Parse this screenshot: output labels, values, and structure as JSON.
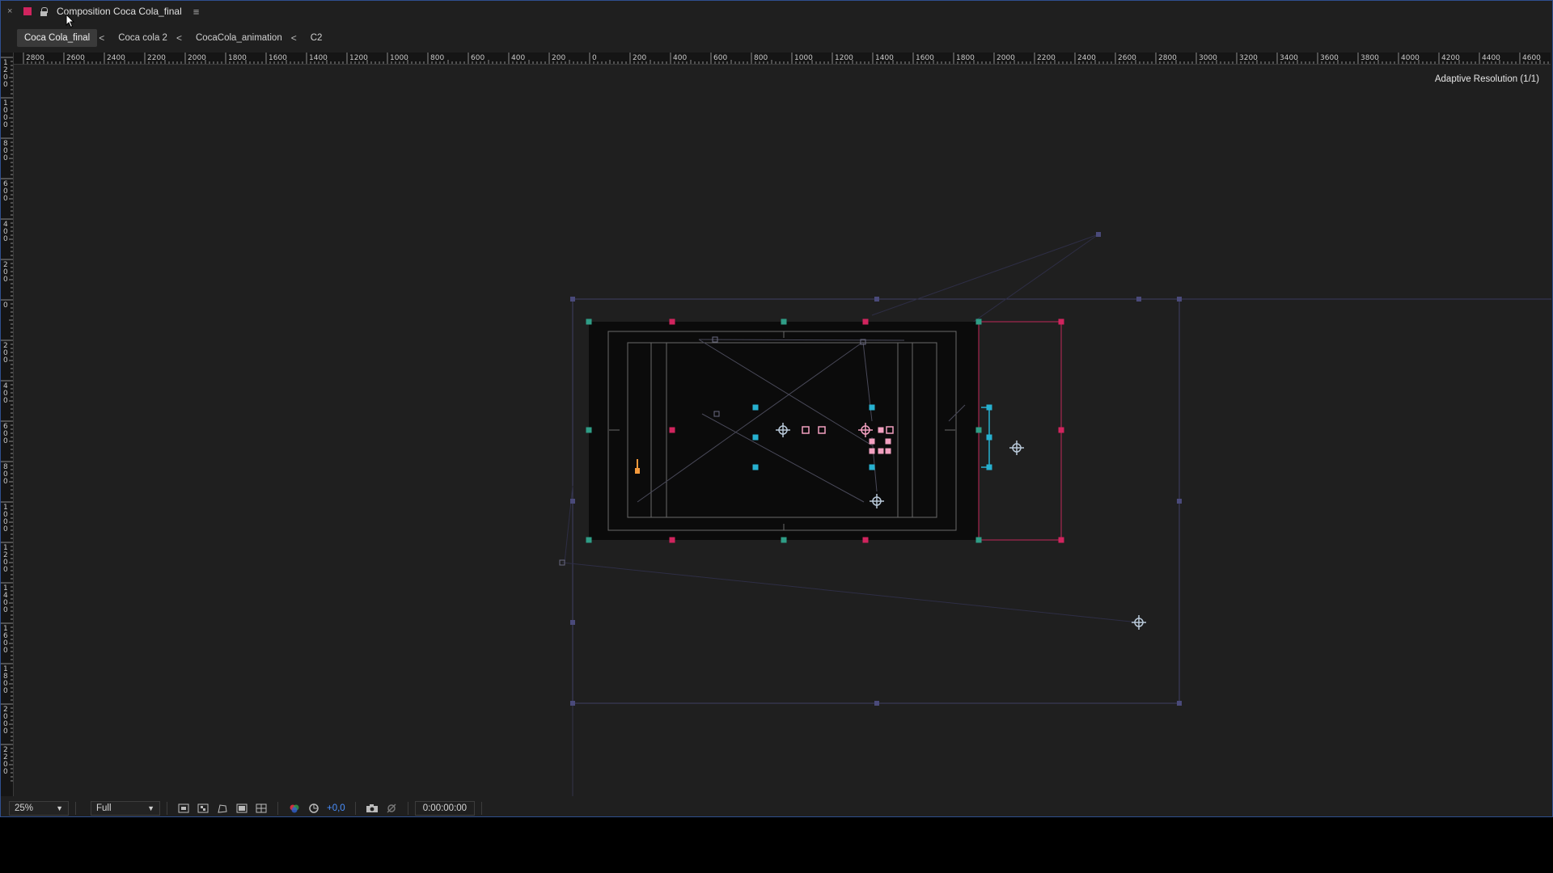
{
  "title_bar": {
    "close_glyph": "×",
    "label_color": "#d0245e",
    "title": "Composition Coca Cola_final",
    "menu_glyph": "≡"
  },
  "tabs": [
    {
      "label": "Coca Cola_final",
      "active": true
    },
    {
      "label": "Coca cola 2",
      "active": false
    },
    {
      "label": "CocaCola_animation",
      "active": false
    },
    {
      "label": "C2",
      "active": false
    }
  ],
  "breadcrumb_separator": "<",
  "ruler": {
    "horizontal_labels": [
      "2800",
      "2600",
      "2400",
      "2200",
      "2000",
      "1800",
      "1600",
      "1400",
      "1200",
      "1000",
      "800",
      "600",
      "400",
      "200",
      "0",
      "200",
      "400",
      "600",
      "800",
      "1000",
      "1200",
      "1400",
      "1600",
      "1800",
      "2000",
      "2200",
      "2400",
      "2600",
      "2800",
      "3000",
      "3200",
      "3400",
      "3600",
      "3800",
      "4000",
      "4200",
      "4400",
      "4600"
    ],
    "vertical_labels": [
      "1200",
      "1000",
      "800",
      "600",
      "400",
      "200",
      "0",
      "200",
      "400",
      "600",
      "800",
      "1000",
      "1200",
      "1400",
      "1600",
      "1800",
      "2000",
      "2200"
    ]
  },
  "viewer": {
    "adaptive_resolution": "Adaptive Resolution (1/1)"
  },
  "bottom_bar": {
    "zoom": "25%",
    "resolution": "Full",
    "exposure": "+0,0",
    "timecode": "0:00:00:00"
  },
  "icons": [
    "close-icon",
    "lock-icon",
    "panel-menu-icon",
    "mouse-cursor-icon",
    "dropdown-caret-icon",
    "region-of-interest-icon",
    "transparency-grid-icon",
    "mask-path-icon",
    "guides-icon",
    "grid-icon",
    "color-channel-icon",
    "reset-exposure-icon",
    "snapshot-icon",
    "show-snapshot-icon",
    "anchor-point-icon"
  ],
  "colors": {
    "panel_bg": "#1f1f1f",
    "accent_blue": "#2f4f8f",
    "layer_pink": "#d0245e",
    "layer_teal": "#2f9d86",
    "layer_cyan": "#27b1d0",
    "layer_purple": "#4a4a7a",
    "orange_handle": "#f59a3c"
  }
}
